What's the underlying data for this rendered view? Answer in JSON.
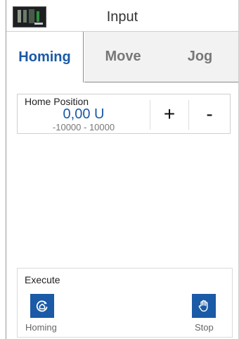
{
  "header": {
    "title": "Input",
    "thumbnail_icon": "device-thumbnail-icon"
  },
  "tabs": [
    {
      "label": "Homing",
      "active": true
    },
    {
      "label": "Move",
      "active": false
    },
    {
      "label": "Jog",
      "active": false
    }
  ],
  "home_position": {
    "label": "Home Position",
    "value": "0,00 U",
    "range": "-10000 - 10000",
    "increment_label": "+",
    "decrement_label": "-"
  },
  "execute": {
    "label": "Execute",
    "homing_label": "Homing",
    "homing_icon": "homing-icon",
    "stop_label": "Stop",
    "stop_icon": "hand-stop-icon"
  },
  "colors": {
    "accent": "#1a5aa6",
    "inactive_tab_bg": "#f2f2f2",
    "muted_text": "#777777"
  }
}
